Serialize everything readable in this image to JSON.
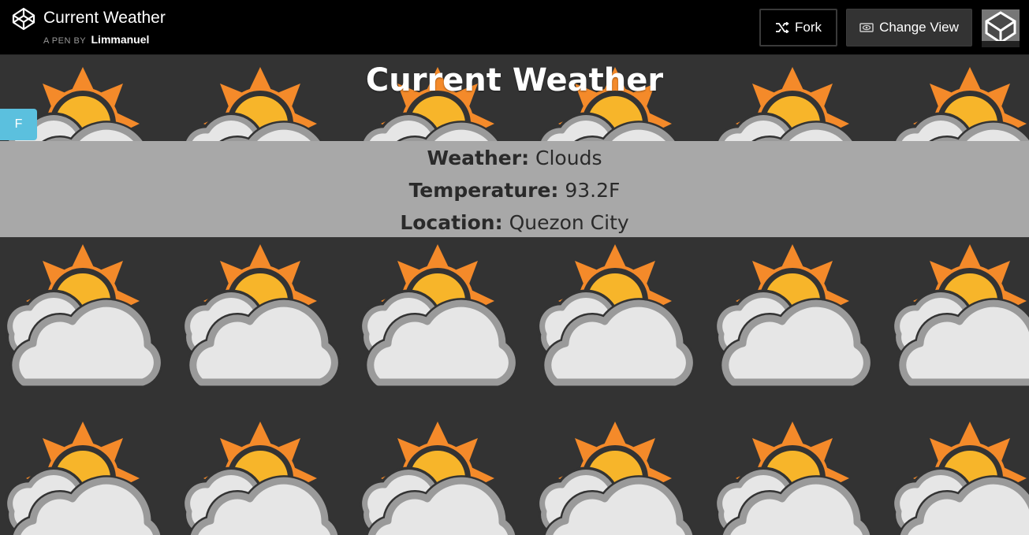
{
  "header": {
    "pen_title": "Current Weather",
    "pen_by_prefix": "A PEN BY",
    "author": "Limmanuel",
    "fork_label": "Fork",
    "change_view_label": "Change View"
  },
  "page": {
    "title": "Current Weather",
    "unit_toggle_label": "F"
  },
  "weather_info": {
    "weather_label": "Weather:",
    "weather_value": "Clouds",
    "temperature_label": "Temperature:",
    "temperature_value": "93.2F",
    "location_label": "Location:",
    "location_value": "Quezon City"
  },
  "icons": {
    "logo": "codepen-logo-icon",
    "fork": "fork-icon",
    "change_view": "eye-icon",
    "background": "partly-cloudy-icon"
  },
  "colors": {
    "topbar": "#000000",
    "background": "#333333",
    "toggle": "#5bc0de",
    "info_panel": "#a8a8a8",
    "sun_rays": "#f48a2a",
    "sun_core": "#f7b52a",
    "cloud_fill": "#e6e6e6",
    "cloud_stroke": "#9a9a9a"
  }
}
